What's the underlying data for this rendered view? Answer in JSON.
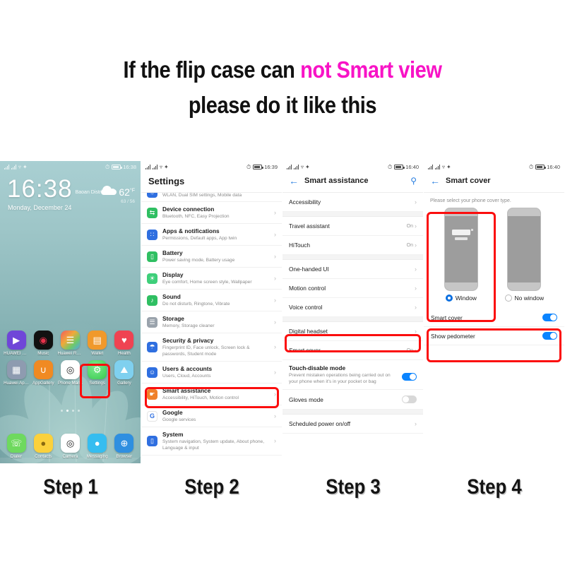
{
  "headline": {
    "line1_a": "If the flip case can ",
    "line1_b": "not Smart view",
    "line2": "please do it like this",
    "accent_color": "#f813c6"
  },
  "steps": [
    {
      "label": "Step 1"
    },
    {
      "label": "Step 2"
    },
    {
      "label": "Step 3"
    },
    {
      "label": "Step 4"
    }
  ],
  "phone1": {
    "status": {
      "time": "16:38",
      "signal_icon": "signal-bars-icon",
      "wifi_icon": "wifi-icon",
      "alarm_icon": "alarm-icon",
      "battery_icon": "battery-icon"
    },
    "clock": "16:38",
    "location": "Baoan District",
    "date": "Monday, December 24",
    "weather": {
      "temp": "62",
      "unit": "°F",
      "range": "63 / 56",
      "icon": "cloud-icon"
    },
    "apps_row1": [
      {
        "label": "HUAWEI Vid..",
        "icon": "huawei-video-icon",
        "glyph": "▶",
        "bg": "#6f46d8",
        "fg": "#ffffff"
      },
      {
        "label": "Music",
        "icon": "music-icon",
        "glyph": "◉",
        "bg": "#111111",
        "fg": "#e8314a"
      },
      {
        "label": "Huawei Read..",
        "icon": "huawei-reader-icon",
        "glyph": "☰",
        "bg": "#ffffff",
        "fg": "#e86a2a"
      },
      {
        "label": "Wallet",
        "icon": "wallet-icon",
        "glyph": "▤",
        "bg": "#f0992b",
        "fg": "#ffffff"
      },
      {
        "label": "Health",
        "icon": "health-icon",
        "glyph": "♥",
        "bg": "#ef4352",
        "fg": "#ffffff"
      }
    ],
    "apps_row2": [
      {
        "label": "Huawei Apps",
        "icon": "huawei-apps-icon",
        "glyph": "▦",
        "bg": "#8e9bb0",
        "fg": "#ffffff"
      },
      {
        "label": "AppGallery",
        "icon": "appgallery-icon",
        "glyph": "∪",
        "bg": "#f08a22",
        "fg": "#ffffff"
      },
      {
        "label": "Phone Man..",
        "icon": "phone-manager-icon",
        "glyph": "◎",
        "bg": "#ffffff",
        "fg": "#1a1a1a"
      },
      {
        "label": "Settings",
        "icon": "settings-icon",
        "glyph": "⚙",
        "bg": "#45d35f",
        "fg": "#ffffff",
        "highlighted": true
      },
      {
        "label": "Gallery",
        "icon": "gallery-icon",
        "glyph": "⛰",
        "bg": "#7fd0ef",
        "fg": "#ffffff"
      }
    ],
    "dock": [
      {
        "label": "Dialer",
        "icon": "phone-icon",
        "glyph": "✆",
        "bg": "#6ed95e",
        "fg": "#ffffff"
      },
      {
        "label": "Contacts",
        "icon": "contacts-icon",
        "glyph": "●",
        "bg": "#fbd13c",
        "fg": "#8a6a10"
      },
      {
        "label": "Camera",
        "icon": "camera-icon",
        "glyph": "◎",
        "bg": "#ffffff",
        "fg": "#1a1a1a"
      },
      {
        "label": "Messaging",
        "icon": "messaging-icon",
        "glyph": "○",
        "bg": "#35bdf0",
        "fg": "#ffffff"
      },
      {
        "label": "Browser",
        "icon": "browser-icon",
        "glyph": "⊕",
        "bg": "#2f8fe0",
        "fg": "#ffffff"
      }
    ],
    "page_dots": 4,
    "page_dot_active": 1
  },
  "phone2": {
    "status": {
      "time": "16:39"
    },
    "title": "Settings",
    "partial_row_sub": "WLAN, Dual SIM settings, Mobile data",
    "rows": [
      {
        "title": "Device connection",
        "sub": "Bluetooth, NFC, Easy Projection",
        "icon": "device-connection-icon",
        "glyph": "⇆",
        "bg": "#2fbf62"
      },
      {
        "title": "Apps & notifications",
        "sub": "Permissions, Default apps, App twin",
        "icon": "apps-notifications-icon",
        "glyph": "∷",
        "bg": "#2f6fe0"
      },
      {
        "title": "Battery",
        "sub": "Power saving mode, Battery usage",
        "icon": "battery-settings-icon",
        "glyph": "▯",
        "bg": "#2fbf62"
      },
      {
        "title": "Display",
        "sub": "Eye comfort, Home screen style, Wallpaper",
        "icon": "display-icon",
        "glyph": "☀",
        "bg": "#3ecf7a"
      },
      {
        "title": "Sound",
        "sub": "Do not disturb, Ringtone, Vibrate",
        "icon": "sound-icon",
        "glyph": "♪",
        "bg": "#2fbf62"
      },
      {
        "title": "Storage",
        "sub": "Memory, Storage cleaner",
        "icon": "storage-icon",
        "glyph": "☲",
        "bg": "#9aa3ac"
      },
      {
        "title": "Security & privacy",
        "sub": "Fingerprint ID, Face unlock, Screen lock & passwords, Student mode",
        "icon": "security-privacy-icon",
        "glyph": "⛨",
        "bg": "#2f6fe0"
      },
      {
        "title": "Users & accounts",
        "sub": "Users, Cloud, Accounts",
        "icon": "users-accounts-icon",
        "glyph": "☺",
        "bg": "#2f6fe0"
      },
      {
        "title": "Smart assistance",
        "sub": "Accessibility, HiTouch, Motion control",
        "icon": "smart-assistance-icon",
        "glyph": "☝",
        "bg": "#f0812a",
        "highlighted": true
      },
      {
        "title": "Google",
        "sub": "Google services",
        "icon": "google-icon",
        "glyph": "G",
        "bg": "#ffffff",
        "fg": "#2f6fe0"
      },
      {
        "title": "System",
        "sub": "System navigation, System update, About phone, Language & input",
        "icon": "system-icon",
        "glyph": "▯",
        "bg": "#2f6fe0"
      }
    ]
  },
  "phone3": {
    "status": {
      "time": "16:40"
    },
    "back_icon": "back-arrow-icon",
    "title": "Smart assistance",
    "search_icon": "search-icon",
    "rows": [
      {
        "label": "Accessibility",
        "value": "",
        "type": "link"
      },
      {
        "gap": true
      },
      {
        "label": "Travel assistant",
        "value": "On",
        "type": "link"
      },
      {
        "label": "HiTouch",
        "value": "On",
        "type": "link"
      },
      {
        "gap": true
      },
      {
        "label": "One-handed UI",
        "value": "",
        "type": "link"
      },
      {
        "label": "Motion control",
        "value": "",
        "type": "link"
      },
      {
        "label": "Voice control",
        "value": "",
        "type": "link"
      },
      {
        "gap": true
      },
      {
        "label": "Digital headset",
        "value": "",
        "type": "link"
      },
      {
        "label": "Smart cover",
        "value": "On",
        "type": "link",
        "highlighted": true
      },
      {
        "label": "Touch-disable mode",
        "sub": "Prevent mistaken operations being carried out on your phone when it's in your pocket or bag",
        "type": "toggle",
        "on": true
      },
      {
        "label": "Gloves mode",
        "type": "toggle",
        "on": false
      },
      {
        "gap": true
      },
      {
        "label": "Scheduled power on/off",
        "value": "",
        "type": "link"
      }
    ]
  },
  "phone4": {
    "status": {
      "time": "16:40"
    },
    "back_icon": "back-arrow-icon",
    "title": "Smart cover",
    "hint": "Please select your phone cover type.",
    "covers": [
      {
        "label": "Window",
        "selected": true,
        "has_window": true
      },
      {
        "label": "No window",
        "selected": false,
        "has_window": false
      }
    ],
    "toggles": [
      {
        "label": "Smart cover",
        "on": true
      },
      {
        "label": "Show pedometer",
        "on": true
      }
    ]
  }
}
